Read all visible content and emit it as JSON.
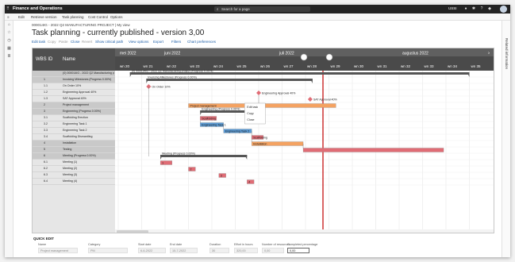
{
  "app": {
    "title": "Finance and Operations",
    "search_placeholder": "Search for a page",
    "entity": "USSI"
  },
  "menu": [
    "Edit",
    "Retrieve version",
    "Task planning",
    "Cost Control",
    "Options"
  ],
  "breadcrumb": "000014IG - 2022 Q2 MANUFACTURING PROJECT  |  My view",
  "page_title": "Task planning - currently published - version 3,00",
  "actions": [
    {
      "label": "Edit task",
      "enabled": true
    },
    {
      "label": "Copy",
      "enabled": false
    },
    {
      "label": "Paste",
      "enabled": false
    },
    {
      "label": "Close",
      "enabled": true
    },
    {
      "label": "Revert",
      "enabled": false
    },
    {
      "label": "Show critical path",
      "enabled": true
    },
    {
      "label": "View options",
      "enabled": true
    },
    {
      "label": "Export",
      "enabled": true
    },
    {
      "label": "Filters",
      "enabled": true
    },
    {
      "label": "Chart preferences",
      "enabled": true
    }
  ],
  "right_pane_label": "Related information",
  "grid": {
    "col_wbs": "WBS ID",
    "col_name": "Name",
    "rows": [
      {
        "wbs": "",
        "name": "(0) 000014IG - 2022 Q2 Manufacturing p",
        "shade": true
      },
      {
        "wbs": "1",
        "name": "Invoicing Milestones (Progress 0.00%)",
        "shade": true
      },
      {
        "wbs": "1.1",
        "name": "On Order 10%",
        "shade": false
      },
      {
        "wbs": "1.2",
        "name": "Engineering Approval 40%",
        "shade": false
      },
      {
        "wbs": "1.3",
        "name": "SAT Approval 40%",
        "shade": false
      },
      {
        "wbs": "2",
        "name": "Project management",
        "shade": true
      },
      {
        "wbs": "3",
        "name": "Engineering (Progress 0.00%)",
        "shade": true
      },
      {
        "wbs": "3.1",
        "name": "Scaffolding Erection",
        "shade": false
      },
      {
        "wbs": "3.2",
        "name": "Engineering Task 1",
        "shade": false
      },
      {
        "wbs": "3.3",
        "name": "Engineering Task 2",
        "shade": false
      },
      {
        "wbs": "3.4",
        "name": "Scaffolding Dismantling",
        "shade": false
      },
      {
        "wbs": "4",
        "name": "Installation",
        "shade": true
      },
      {
        "wbs": "5",
        "name": "Testing",
        "shade": true
      },
      {
        "wbs": "6",
        "name": "Meeting (Progress 0.00%)",
        "shade": true
      },
      {
        "wbs": "6.1",
        "name": "Meeting (1)",
        "shade": false
      },
      {
        "wbs": "6.2",
        "name": "Meeting (2)",
        "shade": false
      },
      {
        "wbs": "6.3",
        "name": "Meeting (3)",
        "shade": false
      },
      {
        "wbs": "6.4",
        "name": "Meeting (4)",
        "shade": false
      }
    ]
  },
  "timeline": {
    "months": [
      "mei 2022",
      "juni 2022",
      "juli 2022",
      "augustus 2022"
    ],
    "weeks": [
      "wn 20",
      "wn 21",
      "wn 22",
      "wn 23",
      "wn 24",
      "wn 25",
      "wn 26",
      "wn 27",
      "wn 28",
      "wn 29",
      "wn 30",
      "wn 31",
      "wn 32",
      "wn 33",
      "wn 34",
      "wn 35"
    ]
  },
  "bar_labels": {
    "summary": "(0) 000014IG - 2022 Q2 Manufacturing project (Progress 0.00%)",
    "invoicing": "Invoicing Milestones (Progress 0.00%)",
    "on_order": "On Order 10%",
    "eng_approval": "Engineering Approval 40%",
    "sat_approval": "SAT Approval 40%",
    "pm": "Project management",
    "engineering": "Engineering (Progress 0.00%)",
    "scaffold_erect": "Scaffolding",
    "eng_task1": "Engineering Task 1",
    "eng_task2": "Engineering Task 2",
    "scaffold_dis": "Scaffolding",
    "installation": "Installation",
    "meeting": "Meeting (Progress 0.00%)",
    "m1": "1",
    "m2": "2",
    "m3": "3",
    "m4": "4"
  },
  "context_menu": [
    "Edit task",
    "Copy",
    "Close"
  ],
  "quick_edit": {
    "title": "QUICK EDIT",
    "labels": [
      "Name",
      "Category",
      "Start date",
      "End date",
      "Duration",
      "Effort in hours",
      "Number of resources",
      "Completed percentage"
    ],
    "values": [
      "Project management",
      "PM",
      "6-6-2022",
      "15-7-2022",
      "30",
      "320,00",
      "0,00",
      "0,00"
    ]
  },
  "colors": {
    "summary": "#555555",
    "pm": "#f4a261",
    "task": "#5b9bd5",
    "milestone": "#e06c75",
    "today": "#c00000"
  }
}
